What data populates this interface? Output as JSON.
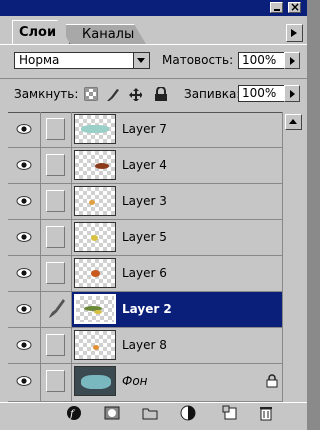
{
  "tabs": [
    {
      "label": "Слои",
      "active": true
    },
    {
      "label": "Каналы",
      "active": false
    }
  ],
  "options": {
    "blend_mode": "Норма",
    "opacity_label": "Матовость:",
    "opacity_value": "100%",
    "lock_label": "Замкнуть:",
    "fill_label": "Запивка:",
    "fill_value": "100%"
  },
  "layers": [
    {
      "name": "Layer 7",
      "selected": false,
      "thumb_color": "#9ad0c8"
    },
    {
      "name": "Layer 4",
      "selected": false,
      "thumb_color": "#8b3a1a"
    },
    {
      "name": "Layer 3",
      "selected": false,
      "thumb_color": "#e0a040"
    },
    {
      "name": "Layer 5",
      "selected": false,
      "thumb_color": "#d8c040"
    },
    {
      "name": "Layer 6",
      "selected": false,
      "thumb_color": "#c85a1e"
    },
    {
      "name": "Layer 2",
      "selected": true,
      "thumb_color": "#6a8a3a"
    },
    {
      "name": "Layer 8",
      "selected": false,
      "thumb_color": "#e09030"
    },
    {
      "name": "Фон",
      "selected": false,
      "thumb_color": "#7ab8c0",
      "locked": true
    }
  ],
  "colors": {
    "selection": "#0a1f7a",
    "panel": "#c6c6c6"
  }
}
